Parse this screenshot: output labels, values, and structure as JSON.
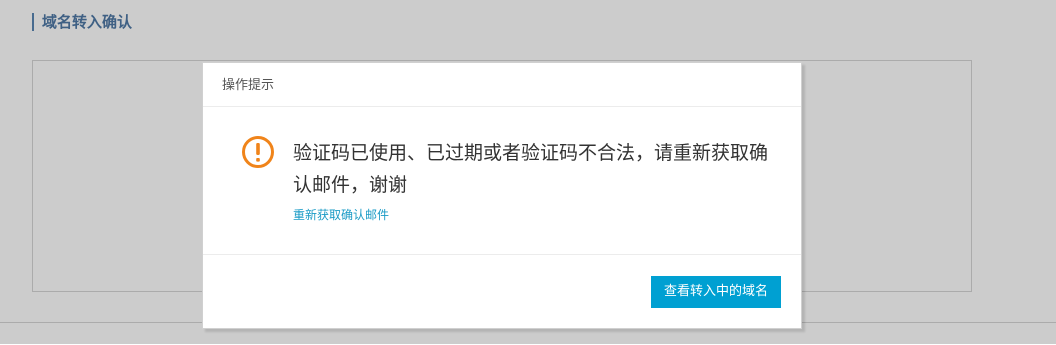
{
  "page": {
    "title": "域名转入确认"
  },
  "dialog": {
    "title": "操作提示",
    "icon": "exclamation-circle-icon",
    "icon_color": "#f0841a",
    "message": "验证码已使用、已过期或者验证码不合法，请重新获取确认邮件，谢谢",
    "resend_link": "重新获取确认邮件",
    "primary_button": "查看转入中的域名",
    "primary_color": "#00a0d2",
    "link_color": "#1a9bc6"
  }
}
